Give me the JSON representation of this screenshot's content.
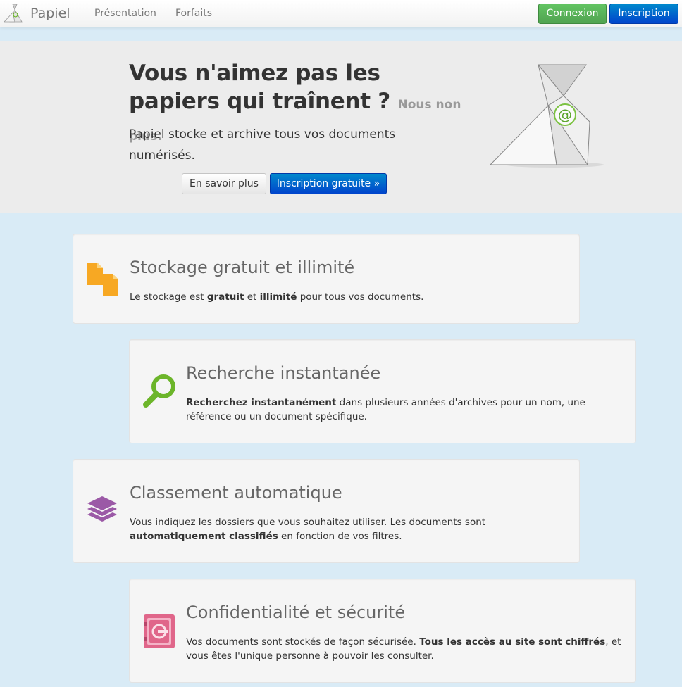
{
  "nav": {
    "brand": "Papiel",
    "links": [
      "Présentation",
      "Forfaits"
    ],
    "login": "Connexion",
    "signup": "Inscription"
  },
  "hero": {
    "title": "Vous n'aimez pas les papiers qui traînent ?",
    "subtitle": "Nous non plus.",
    "text": "Papiel stocke et archive tous vos documents numérisés.",
    "more_button": "En savoir plus",
    "free_button": "Inscription gratuite »"
  },
  "features": [
    {
      "icon": "documents-icon",
      "color": "#f7a823",
      "title": "Stockage gratuit et illimité",
      "desc_parts": [
        {
          "t": "Le stockage est ",
          "b": false
        },
        {
          "t": "gratuit",
          "b": true
        },
        {
          "t": " et ",
          "b": false
        },
        {
          "t": "illimité",
          "b": true
        },
        {
          "t": " pour tous vos documents.",
          "b": false
        }
      ]
    },
    {
      "icon": "search-icon",
      "color": "#6cb52a",
      "title": "Recherche instantanée",
      "desc_parts": [
        {
          "t": "Recherchez instantanément",
          "b": true
        },
        {
          "t": " dans plusieurs années d'archives pour un nom, une référence ou un document spécifique.",
          "b": false
        }
      ]
    },
    {
      "icon": "layers-icon",
      "color": "#9b59a6",
      "title": "Classement automatique",
      "desc_parts": [
        {
          "t": "Vous indiquez les dossiers que vous souhaitez utiliser. Les documents sont ",
          "b": false
        },
        {
          "t": "automatiquement classifiés",
          "b": true
        },
        {
          "t": " en fonction de vos filtres.",
          "b": false
        }
      ]
    },
    {
      "icon": "safe-icon",
      "color": "#e0668a",
      "title": "Confidentialité et sécurité",
      "desc_parts": [
        {
          "t": "Vos documents sont stockés de façon sécurisée. ",
          "b": false
        },
        {
          "t": "Tous les accès au site sont chiffrés",
          "b": true
        },
        {
          "t": ", et vous êtes l'unique personne à pouvoir les consulter.",
          "b": false
        }
      ]
    }
  ]
}
